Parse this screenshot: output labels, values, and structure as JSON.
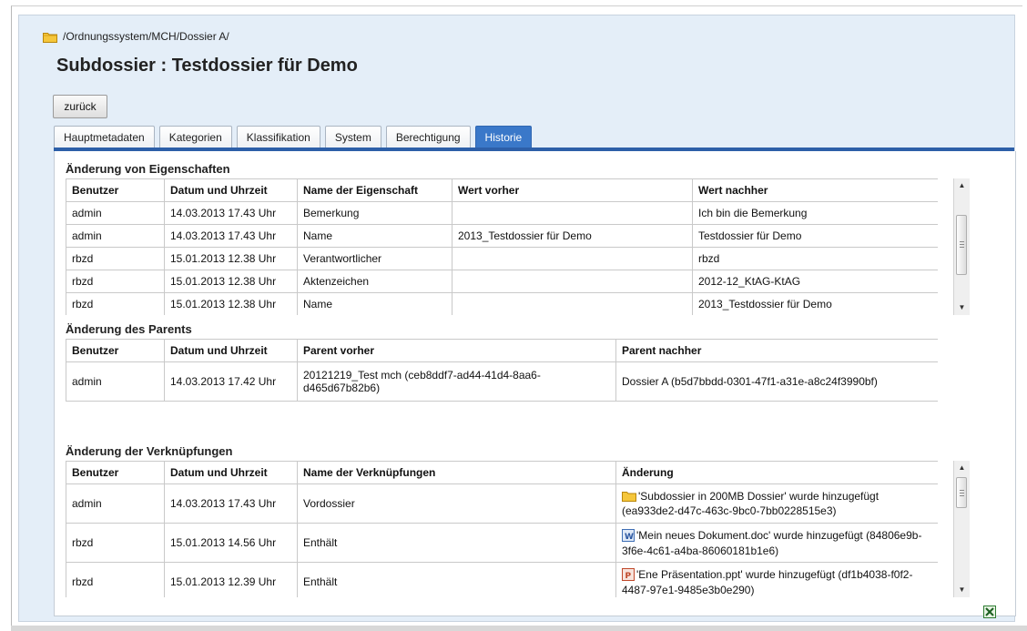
{
  "breadcrumb": {
    "path": "/Ordnungssystem/MCH/Dossier A/",
    "icon": "folder-icon"
  },
  "page": {
    "title": "Subdossier : Testdossier für Demo"
  },
  "toolbar": {
    "back_label": "zurück"
  },
  "tabs": [
    {
      "label": "Hauptmetadaten",
      "active": false
    },
    {
      "label": "Kategorien",
      "active": false
    },
    {
      "label": "Klassifikation",
      "active": false
    },
    {
      "label": "System",
      "active": false
    },
    {
      "label": "Berechtigung",
      "active": false
    },
    {
      "label": "Historie",
      "active": true
    }
  ],
  "colors": {
    "accent": "#2d5fa8",
    "active_tab": "#3a78c9",
    "panel_bg": "#e4eef8"
  },
  "properties_section": {
    "title": "Änderung von Eigenschaften",
    "headers": [
      "Benutzer",
      "Datum und Uhrzeit",
      "Name der Eigenschaft",
      "Wert vorher",
      "Wert nachher"
    ],
    "rows": [
      [
        "admin",
        "14.03.2013 17.43 Uhr",
        "Bemerkung",
        "",
        "Ich bin die Bemerkung"
      ],
      [
        "admin",
        "14.03.2013 17.43 Uhr",
        "Name",
        "2013_Testdossier für Demo",
        "Testdossier für Demo"
      ],
      [
        "rbzd",
        "15.01.2013 12.38 Uhr",
        "Verantwortlicher",
        "",
        "rbzd"
      ],
      [
        "rbzd",
        "15.01.2013 12.38 Uhr",
        "Aktenzeichen",
        "",
        "2012-12_KtAG-KtAG"
      ],
      [
        "rbzd",
        "15.01.2013 12.38 Uhr",
        "Name",
        "",
        "2013_Testdossier für Demo"
      ]
    ]
  },
  "parents_section": {
    "title": "Änderung des Parents",
    "headers": [
      "Benutzer",
      "Datum und Uhrzeit",
      "Parent vorher",
      "Parent nachher"
    ],
    "rows": [
      [
        "admin",
        "14.03.2013 17.42 Uhr",
        "20121219_Test mch (ceb8ddf7-ad44-41d4-8aa6-d465d67b82b6)",
        "Dossier A (b5d7bbdd-0301-47f1-a31e-a8c24f3990bf)"
      ]
    ]
  },
  "links_section": {
    "title": "Änderung der Verknüpfungen",
    "headers": [
      "Benutzer",
      "Datum und Uhrzeit",
      "Name der Verknüpfungen",
      "Änderung"
    ],
    "rows": [
      [
        "admin",
        "14.03.2013 17.43 Uhr",
        "Vordossier",
        "'Subdossier in 200MB Dossier' wurde hinzugefügt (ea933de2-d47c-463c-9bc0-7bb0228515e3)",
        "folder-icon"
      ],
      [
        "rbzd",
        "15.01.2013 14.56 Uhr",
        "Enthält",
        "'Mein neues Dokument.doc' wurde hinzugefügt (84806e9b-3f6e-4c61-a4ba-86060181b1e6)",
        "word-doc-icon"
      ],
      [
        "rbzd",
        "15.01.2013 12.39 Uhr",
        "Enthält",
        "'Ene Präsentation.ppt' wurde hinzugefügt (df1b4038-f0f2-4487-97e1-9485e3b0e290)",
        "powerpoint-icon"
      ]
    ]
  },
  "footer": {
    "export_icon": "excel-export-icon"
  }
}
